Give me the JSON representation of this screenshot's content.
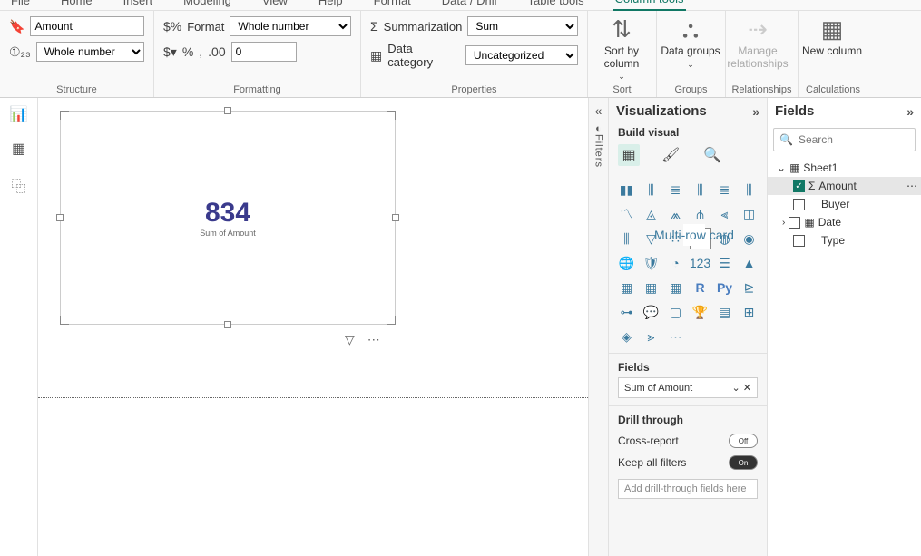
{
  "tabs": {
    "file": "File",
    "home": "Home",
    "insert": "Insert",
    "modeling": "Modeling",
    "view": "View",
    "help": "Help",
    "format": "Format",
    "data": "Data / Drill",
    "table": "Table tools",
    "column": "Column tools"
  },
  "ribbon": {
    "name_value": "Amount",
    "datatype_value": "Whole number",
    "format_label": "Format",
    "format_value": "Whole number",
    "decimals": "0",
    "summarization_label": "Summarization",
    "summarization_value": "Sum",
    "category_label": "Data category",
    "category_value": "Uncategorized",
    "sort": "Sort by column",
    "groups": "Data groups",
    "rel": "Manage relationships",
    "newcol": "New column",
    "grp_structure": "Structure",
    "grp_formatting": "Formatting",
    "grp_properties": "Properties",
    "grp_sort": "Sort",
    "grp_groups": "Groups",
    "grp_rel": "Relationships",
    "grp_calc": "Calculations"
  },
  "card": {
    "value": "834",
    "label": "Sum of Amount"
  },
  "viz": {
    "title": "Visualizations",
    "build": "Build visual",
    "tooltip": "Multi-row card",
    "fields": "Fields",
    "well": "Sum of Amount",
    "drill": "Drill through",
    "cross": "Cross-report",
    "keep": "Keep all filters",
    "off": "Off",
    "on": "On",
    "addfields": "Add drill-through fields here"
  },
  "filters": "Filters",
  "fields": {
    "title": "Fields",
    "search": "Search",
    "table": "Sheet1",
    "c1": "Amount",
    "c2": "Buyer",
    "c3": "Date",
    "c4": "Type"
  }
}
